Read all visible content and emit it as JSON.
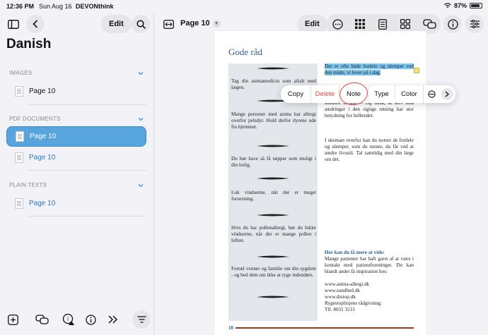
{
  "status": {
    "time": "12:36 PM",
    "date": "Sun Aug 16",
    "app": "DEVONthink",
    "battery": "87%",
    "battery_level": 0.87
  },
  "sidebar": {
    "title": "Danish",
    "edit_label": "Edit",
    "sections": [
      {
        "header": "IMAGES",
        "items": [
          {
            "label": "Page 10"
          }
        ]
      },
      {
        "header": "PDF DOCUMENTS",
        "items": [
          {
            "label": "Page 10"
          },
          {
            "label": "Page 10"
          }
        ]
      },
      {
        "header": "PLAIN TEXTS",
        "items": [
          {
            "label": "Page 10"
          }
        ]
      }
    ]
  },
  "toolbar": {
    "title": "Page 10",
    "edit_label": "Edit"
  },
  "context_menu": {
    "copy": "Copy",
    "delete": "Delete",
    "note": "Note",
    "type": "Type",
    "color": "Color"
  },
  "page": {
    "heading": "Gode råd",
    "tips": [
      "Tag din astmamedicin som aftalt med lægen.",
      "Mange personer med astma har allergi overfor pelsdyr. Hold derfor dyrene ude fra hjemmet.",
      "Du bør have så få tæpper som muligt i din bolig.",
      "Luk vinduerne, når der er meget forurening.",
      "Hvis du har pollenallergi, bør du lukke vinduerne, når der er mange pollen i luften.",
      "Fortæl venner og familie om din sygdom - og bed dem om ikke at ryge indendørs."
    ],
    "highlighted": "Der er ofte både fordele og ulemper ved den måde, vi lever på i dag.",
    "para1": "og hvilke fordele du kan opnå ved en sundere livsstil. - Og husk, at selv små ændringer i den rigtige retning har stor betydning for helbredet.",
    "para2": "I skemaet overfor kan du notere de fordele og ulemper, som du mener, du får ved at ændre livsstil. Tal samtidig med din læge om det.",
    "more_heading": "Her kan du få mere at vide:",
    "more_text": "Mange patienter har haft gavn af at være i kontakt med patientforeninger. Du kan blandt andet få inspiration hos:",
    "links": [
      "www.astma-allergi.dk",
      "www.sundhed.dk",
      "www.drstop.dk",
      "Rygestoplinjens rådgivning:",
      "Tlf. 8031 3131"
    ],
    "page_number": "10"
  },
  "colors": {
    "accent": "#57a5dc",
    "highlight": "#7cc5ee",
    "heading": "#2e5f8a",
    "delete": "#e5483f"
  }
}
